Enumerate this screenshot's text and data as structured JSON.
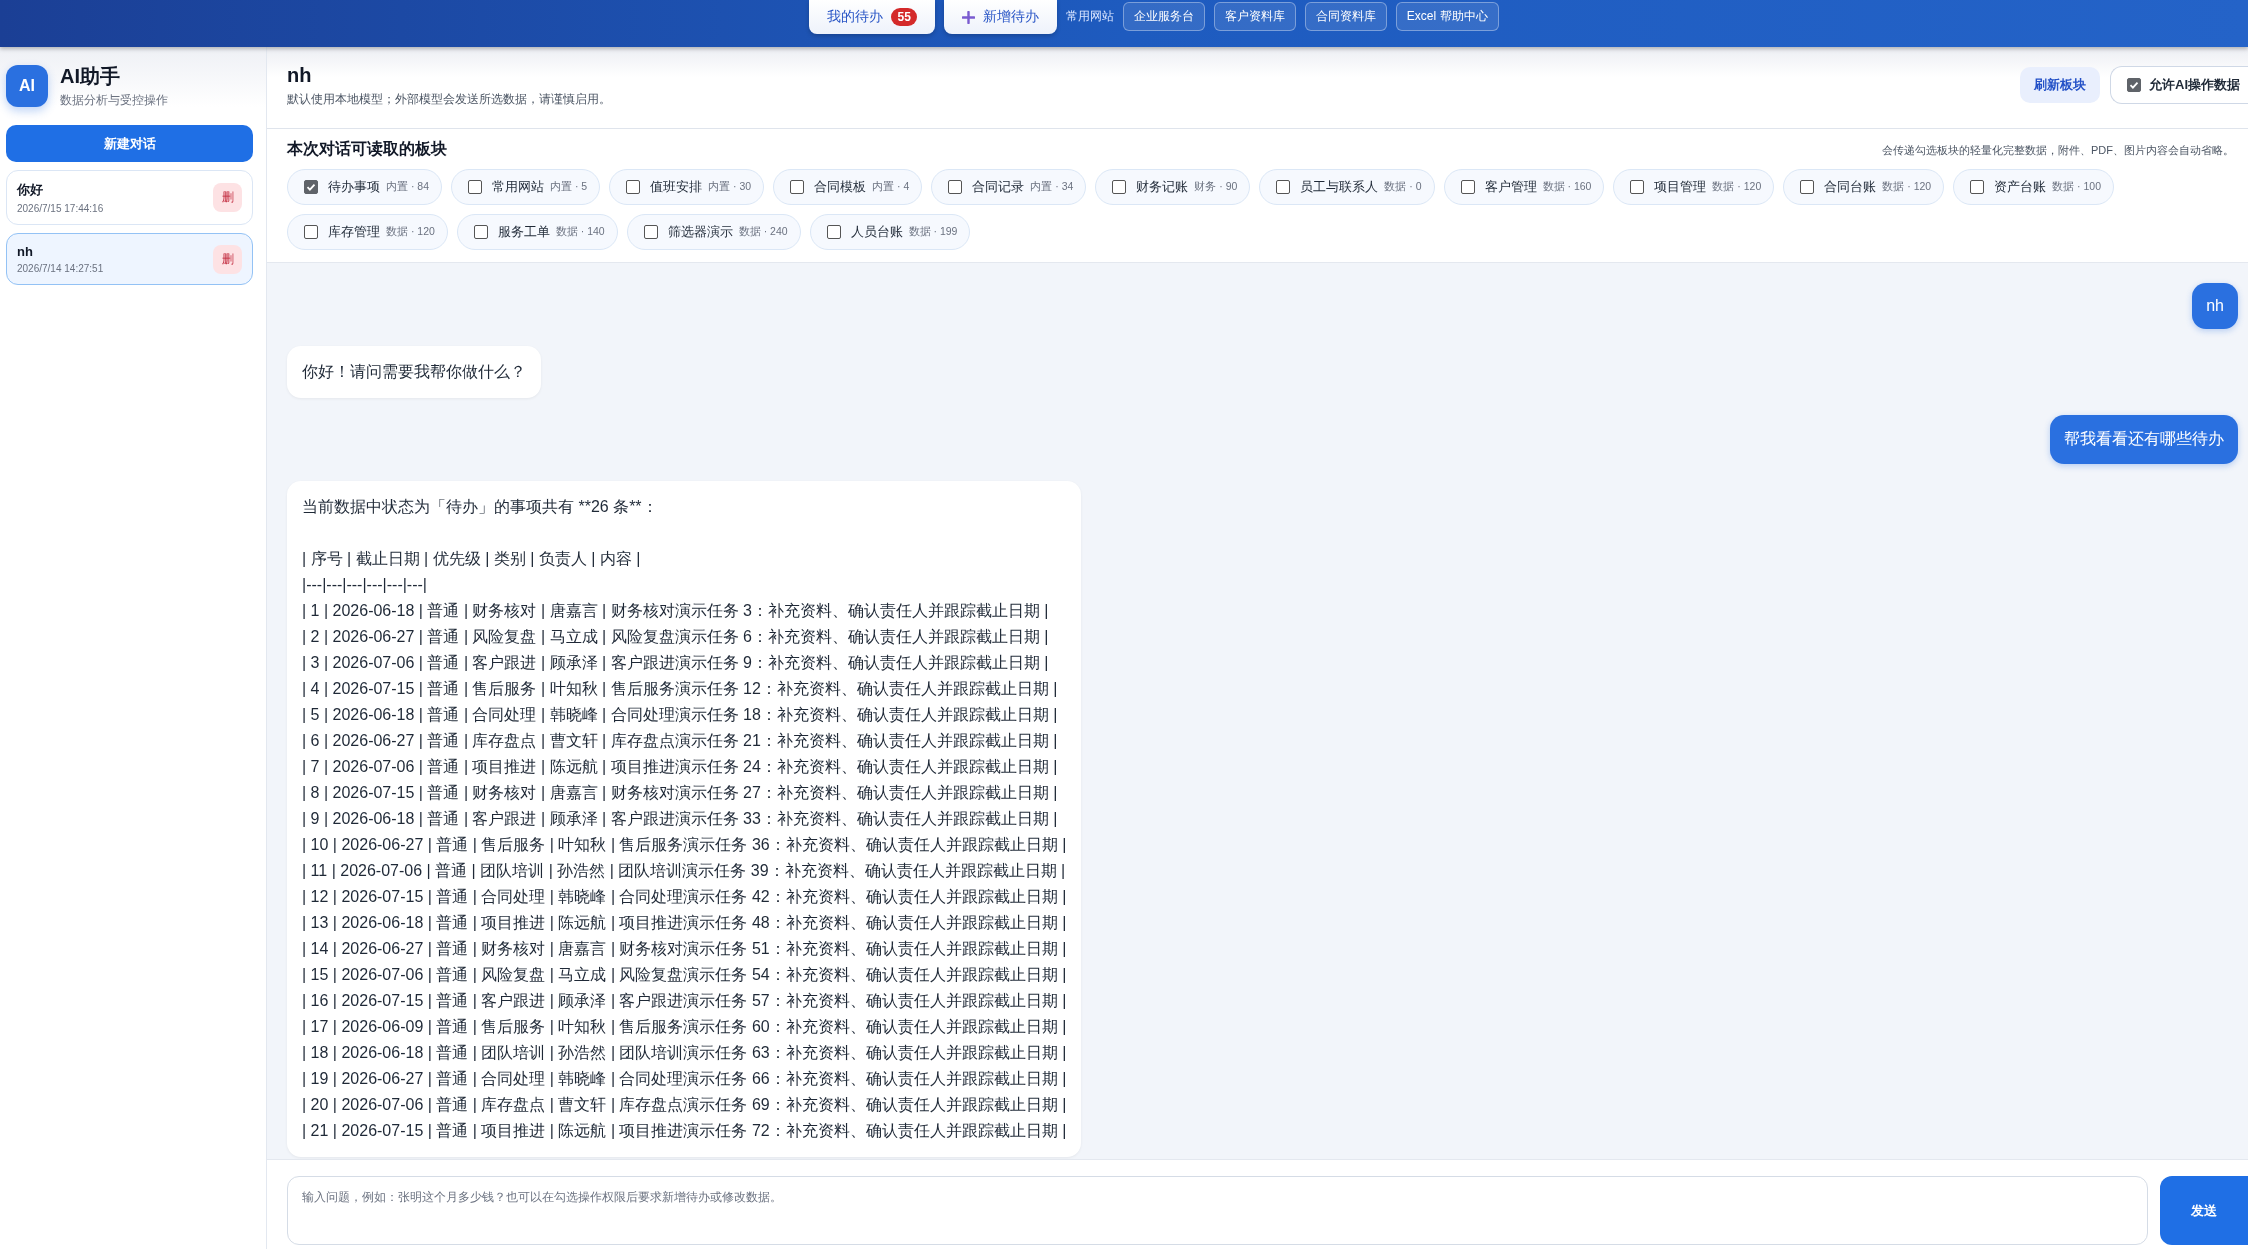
{
  "topbar": {
    "tabs": [
      {
        "label": "我的待办",
        "badge": "55",
        "kind": "todo"
      },
      {
        "label": "新增待办",
        "kind": "add"
      }
    ],
    "links_label": "常用网站",
    "links": [
      "企业服务台",
      "客户资料库",
      "合同资料库",
      "Excel 帮助中心"
    ]
  },
  "sidebar": {
    "logo": "AI",
    "title": "AI助手",
    "subtitle": "数据分析与受控操作",
    "new_button": "新建对话",
    "sessions": [
      {
        "title": "你好",
        "time": "2026/7/15 17:44:16",
        "delete": "删",
        "selected": false
      },
      {
        "title": "nh",
        "time": "2026/7/14 14:27:51",
        "delete": "删",
        "selected": true
      }
    ]
  },
  "header": {
    "title": "nh",
    "subtitle": "默认使用本地模型；外部模型会发送所选数据，请谨慎启用。",
    "refresh_button": "刷新板块",
    "allow_toggle": {
      "label": "允许AI操作数据",
      "checked": true
    }
  },
  "blocks": {
    "title": "本次对话可读取的板块",
    "note": "会传递勾选板块的轻量化完整数据，附件、PDF、图片内容会自动省略。",
    "items": [
      {
        "label": "待办事项",
        "meta": "内置 · 84",
        "checked": true
      },
      {
        "label": "常用网站",
        "meta": "内置 · 5",
        "checked": false
      },
      {
        "label": "值班安排",
        "meta": "内置 · 30",
        "checked": false
      },
      {
        "label": "合同模板",
        "meta": "内置 · 4",
        "checked": false
      },
      {
        "label": "合同记录",
        "meta": "内置 · 34",
        "checked": false
      },
      {
        "label": "财务记账",
        "meta": "财务 · 90",
        "checked": false
      },
      {
        "label": "员工与联系人",
        "meta": "数据 · 0",
        "checked": false
      },
      {
        "label": "客户管理",
        "meta": "数据 · 160",
        "checked": false
      },
      {
        "label": "项目管理",
        "meta": "数据 · 120",
        "checked": false
      },
      {
        "label": "合同台账",
        "meta": "数据 · 120",
        "checked": false
      },
      {
        "label": "资产台账",
        "meta": "数据 · 100",
        "checked": false
      },
      {
        "label": "库存管理",
        "meta": "数据 · 120",
        "checked": false
      },
      {
        "label": "服务工单",
        "meta": "数据 · 140",
        "checked": false
      },
      {
        "label": "筛选器演示",
        "meta": "数据 · 240",
        "checked": false
      },
      {
        "label": "人员台账",
        "meta": "数据 · 199",
        "checked": false
      }
    ]
  },
  "messages": [
    {
      "kind": "user",
      "paragraphs": [
        [
          "nh"
        ]
      ]
    },
    {
      "kind": "assistant",
      "paragraphs": [
        [
          "你好！请问需要我帮你做什么？"
        ]
      ]
    },
    {
      "kind": "user",
      "paragraphs": [
        [
          "帮我看看还有哪些待办"
        ]
      ]
    },
    {
      "kind": "assistant",
      "paragraphs": [
        [
          "当前数据中状态为「待办」的事项共有 **26 条**："
        ],
        [
          "| 序号 | 截止日期 | 优先级 | 类别 | 负责人 | 内容 |",
          "|---|---|---|---|---|---|",
          "| 1 | 2026-06-18 | 普通 | 财务核对 | 唐嘉言 | 财务核对演示任务 3：补充资料、确认责任人并跟踪截止日期 |",
          "| 2 | 2026-06-27 | 普通 | 风险复盘 | 马立成 | 风险复盘演示任务 6：补充资料、确认责任人并跟踪截止日期 |",
          "| 3 | 2026-07-06 | 普通 | 客户跟进 | 顾承泽 | 客户跟进演示任务 9：补充资料、确认责任人并跟踪截止日期 |",
          "| 4 | 2026-07-15 | 普通 | 售后服务 | 叶知秋 | 售后服务演示任务 12：补充资料、确认责任人并跟踪截止日期 |",
          "| 5 | 2026-06-18 | 普通 | 合同处理 | 韩晓峰 | 合同处理演示任务 18：补充资料、确认责任人并跟踪截止日期 |",
          "| 6 | 2026-06-27 | 普通 | 库存盘点 | 曹文轩 | 库存盘点演示任务 21：补充资料、确认责任人并跟踪截止日期 |",
          "| 7 | 2026-07-06 | 普通 | 项目推进 | 陈远航 | 项目推进演示任务 24：补充资料、确认责任人并跟踪截止日期 |",
          "| 8 | 2026-07-15 | 普通 | 财务核对 | 唐嘉言 | 财务核对演示任务 27：补充资料、确认责任人并跟踪截止日期 |",
          "| 9 | 2026-06-18 | 普通 | 客户跟进 | 顾承泽 | 客户跟进演示任务 33：补充资料、确认责任人并跟踪截止日期 |",
          "| 10 | 2026-06-27 | 普通 | 售后服务 | 叶知秋 | 售后服务演示任务 36：补充资料、确认责任人并跟踪截止日期 |",
          "| 11 | 2026-07-06 | 普通 | 团队培训 | 孙浩然 | 团队培训演示任务 39：补充资料、确认责任人并跟踪截止日期 |",
          "| 12 | 2026-07-15 | 普通 | 合同处理 | 韩晓峰 | 合同处理演示任务 42：补充资料、确认责任人并跟踪截止日期 |",
          "| 13 | 2026-06-18 | 普通 | 项目推进 | 陈远航 | 项目推进演示任务 48：补充资料、确认责任人并跟踪截止日期 |",
          "| 14 | 2026-06-27 | 普通 | 财务核对 | 唐嘉言 | 财务核对演示任务 51：补充资料、确认责任人并跟踪截止日期 |",
          "| 15 | 2026-07-06 | 普通 | 风险复盘 | 马立成 | 风险复盘演示任务 54：补充资料、确认责任人并跟踪截止日期 |",
          "| 16 | 2026-07-15 | 普通 | 客户跟进 | 顾承泽 | 客户跟进演示任务 57：补充资料、确认责任人并跟踪截止日期 |",
          "| 17 | 2026-06-09 | 普通 | 售后服务 | 叶知秋 | 售后服务演示任务 60：补充资料、确认责任人并跟踪截止日期 |",
          "| 18 | 2026-06-18 | 普通 | 团队培训 | 孙浩然 | 团队培训演示任务 63：补充资料、确认责任人并跟踪截止日期 |",
          "| 19 | 2026-06-27 | 普通 | 合同处理 | 韩晓峰 | 合同处理演示任务 66：补充资料、确认责任人并跟踪截止日期 |",
          "| 20 | 2026-07-06 | 普通 | 库存盘点 | 曹文轩 | 库存盘点演示任务 69：补充资料、确认责任人并跟踪截止日期 |",
          "| 21 | 2026-07-15 | 普通 | 项目推进 | 陈远航 | 项目推进演示任务 72：补充资料、确认责任人并跟踪截止日期 |"
        ]
      ]
    }
  ],
  "composer": {
    "placeholder": "输入问题，例如：张明这个月多少钱？也可以在勾选操作权限后要求新增待办或修改数据。",
    "send_button": "发送"
  }
}
